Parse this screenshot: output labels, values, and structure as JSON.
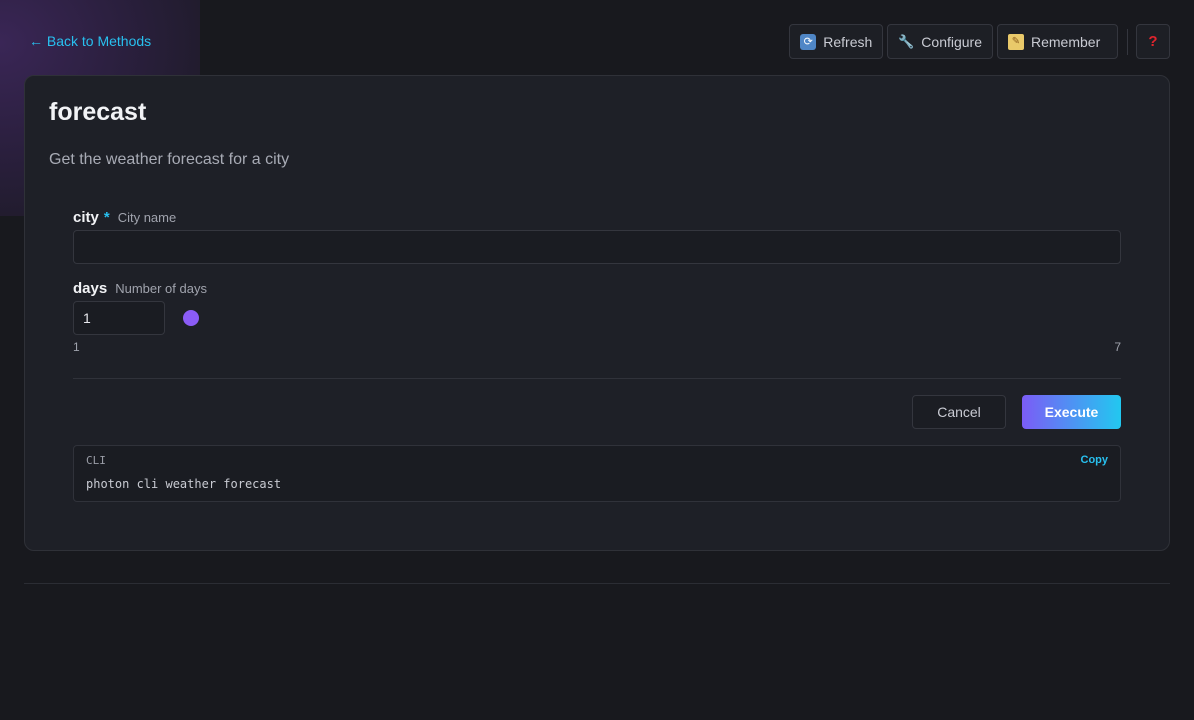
{
  "nav": {
    "back_label": "← Back to Methods"
  },
  "toolbar": {
    "refresh_label": "Refresh",
    "configure_label": "Configure",
    "remember_label": "Remember",
    "help_label": "?"
  },
  "method": {
    "title": "forecast",
    "description": "Get the weather forecast for a city"
  },
  "fields": {
    "city": {
      "name": "city",
      "required_mark": "*",
      "description": "City name",
      "value": "",
      "placeholder": ""
    },
    "days": {
      "name": "days",
      "description": "Number of days",
      "value": "1",
      "min": "1",
      "max": "7",
      "slider_fraction": 0
    }
  },
  "actions": {
    "cancel_label": "Cancel",
    "execute_label": "Execute"
  },
  "cli": {
    "label": "CLI",
    "copy_label": "Copy",
    "command": "photon cli weather forecast"
  },
  "colors": {
    "accent": "#28c0ef",
    "slider": "#8b5cf6",
    "help": "#e0242d"
  },
  "icons": {
    "refresh": "refresh-icon",
    "configure": "wrench-icon",
    "remember": "memo-icon"
  }
}
